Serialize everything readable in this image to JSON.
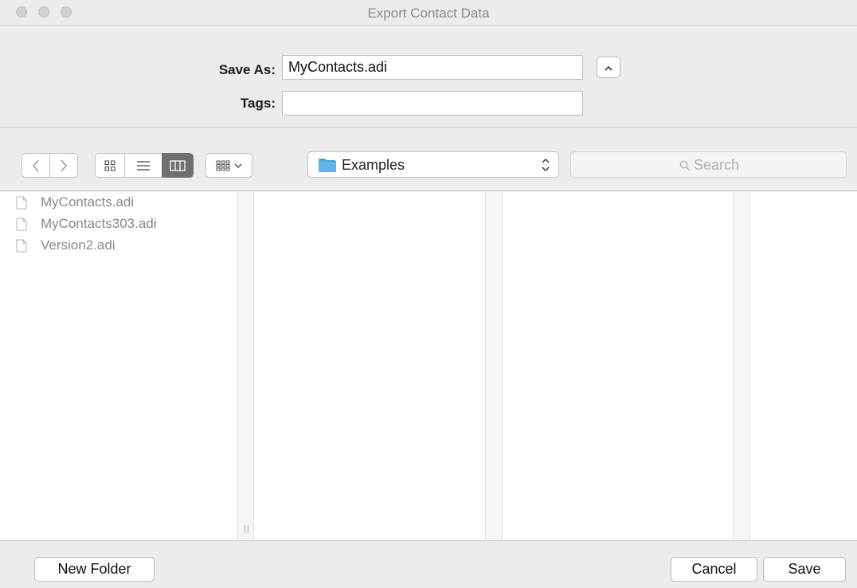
{
  "window": {
    "title": "Export Contact Data"
  },
  "header": {
    "save_as_label": "Save As:",
    "save_as_value": "MyContacts.adi",
    "tags_label": "Tags:",
    "tags_value": ""
  },
  "toolbar": {
    "location": "Examples",
    "search_placeholder": "Search",
    "active_view": "columns"
  },
  "files": [
    {
      "name": "MyContacts.adi"
    },
    {
      "name": "MyContacts303.adi"
    },
    {
      "name": "Version2.adi"
    }
  ],
  "footer": {
    "new_folder_label": "New Folder",
    "cancel_label": "Cancel",
    "save_label": "Save"
  },
  "colors": {
    "folder": "#4aa7e0",
    "active_view_bg": "#6f6f6f"
  },
  "icons": {
    "collapse": "chevron-up-icon",
    "back": "chevron-left-icon",
    "forward": "chevron-right-icon",
    "view_icons": "grid-icon",
    "view_list": "list-icon",
    "view_columns": "columns-icon",
    "arrange": "arrange-icon",
    "folder": "folder-icon",
    "search": "magnifier-icon",
    "file": "document-icon"
  }
}
